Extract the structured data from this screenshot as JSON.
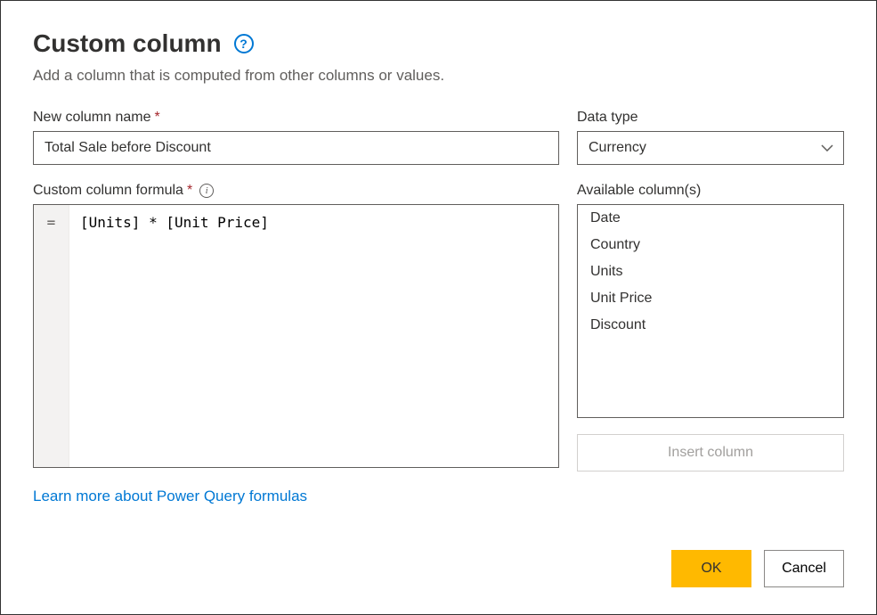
{
  "dialog": {
    "title": "Custom column",
    "subtitle": "Add a column that is computed from other columns or values."
  },
  "fields": {
    "new_column_name_label": "New column name",
    "new_column_name_value": "Total Sale before Discount",
    "data_type_label": "Data type",
    "data_type_value": "Currency",
    "formula_label": "Custom column formula",
    "formula_prefix": "=",
    "formula_value": "[Units] * [Unit Price]",
    "available_columns_label": "Available column(s)"
  },
  "available_columns": [
    "Date",
    "Country",
    "Units",
    "Unit Price",
    "Discount"
  ],
  "actions": {
    "insert_column": "Insert column",
    "learn_more": "Learn more about Power Query formulas",
    "ok": "OK",
    "cancel": "Cancel"
  }
}
